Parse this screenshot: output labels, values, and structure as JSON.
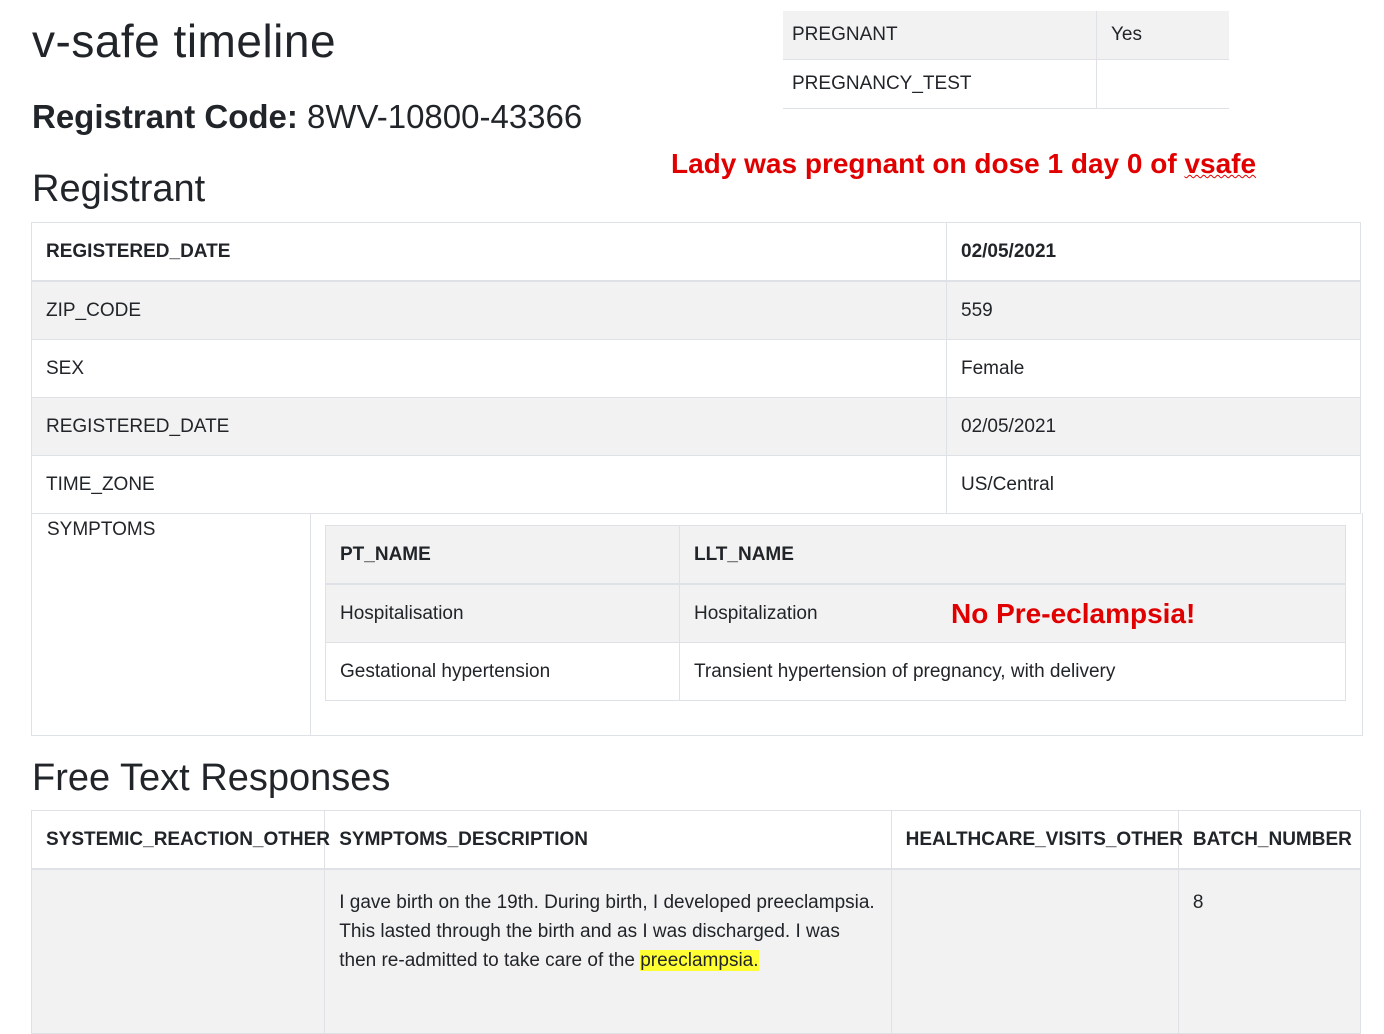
{
  "header": {
    "title": "v-safe timeline",
    "registrant_code_label": "Registrant Code:",
    "registrant_code_value": "8WV-10800-43366"
  },
  "pregnancy_table": {
    "rows": [
      {
        "label": "PREGNANT",
        "value": "Yes"
      },
      {
        "label": "PREGNANCY_TEST",
        "value": ""
      }
    ]
  },
  "annotations": {
    "pregnant_note_prefix": "Lady was pregnant on dose 1 day 0 of ",
    "pregnant_note_word": "vsafe",
    "no_preeclampsia": "No Pre-eclampsia!"
  },
  "registrant": {
    "heading": "Registrant",
    "rows": [
      {
        "label": "REGISTERED_DATE",
        "value": "02/05/2021"
      },
      {
        "label": "ZIP_CODE",
        "value": "559"
      },
      {
        "label": "SEX",
        "value": "Female"
      },
      {
        "label": "REGISTERED_DATE",
        "value": "02/05/2021"
      },
      {
        "label": "TIME_ZONE",
        "value": "US/Central"
      }
    ],
    "symptoms_label": "SYMPTOMS",
    "symptoms_table": {
      "columns": [
        "PT_NAME",
        "LLT_NAME"
      ],
      "rows": [
        [
          "Hospitalisation",
          "Hospitalization"
        ],
        [
          "Gestational hypertension",
          "Transient hypertension of pregnancy, with delivery"
        ]
      ]
    }
  },
  "free_text": {
    "heading": "Free Text Responses",
    "columns": [
      "SYSTEMIC_REACTION_OTHER",
      "SYMPTOMS_DESCRIPTION",
      "HEALTHCARE_VISITS_OTHER",
      "BATCH_NUMBER"
    ],
    "row": {
      "systemic_reaction_other": "",
      "symptoms_description_main": "I gave birth on the 19th. During birth, I developed preeclampsia. This lasted through the birth and as I was discharged. I was then re-admitted to take care of the ",
      "symptoms_description_highlight": "preeclampsia.",
      "healthcare_visits_other": "",
      "batch_number": "8"
    },
    "highlight_color": "#ffff33"
  },
  "colors": {
    "annotation_red": "#e00000",
    "row_shade": "#f2f2f2",
    "border": "#dee2e6"
  }
}
